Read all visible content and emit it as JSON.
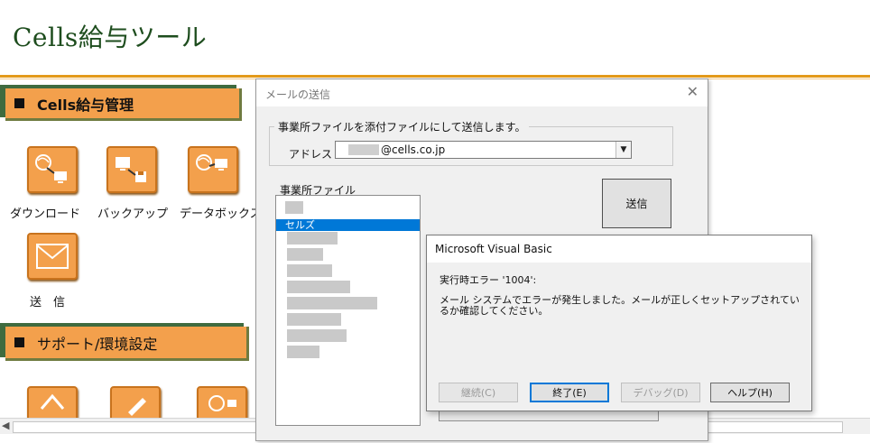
{
  "app": {
    "title": "Cells給与ツール"
  },
  "sections": [
    {
      "label": "Cells給与管理"
    },
    {
      "label": "サポート/環境設定"
    }
  ],
  "tools": [
    {
      "label": "ダウンロード",
      "icon": "download-icon"
    },
    {
      "label": "バックアップ",
      "icon": "backup-icon"
    },
    {
      "label": "データボックス",
      "icon": "databox-icon"
    },
    {
      "label": "送　信",
      "icon": "mail-icon"
    }
  ],
  "mail_dialog": {
    "title": "メールの送信",
    "group_legend": "事業所ファイルを添付ファイルにして送信します。",
    "address_label": "アドレス",
    "address_value": "@cells.co.jp",
    "files_label": "事業所ファイル",
    "selected_file": "セルズ",
    "send_label": "送信"
  },
  "vb_dialog": {
    "title": "Microsoft Visual Basic",
    "error_line": "実行時エラー '1004':",
    "message": "メール システムでエラーが発生しました。メールが正しくセットアップされているか確認してください。",
    "buttons": {
      "continue": "継続(C)",
      "end": "終了(E)",
      "debug": "デバッグ(D)",
      "help": "ヘルプ(H)"
    }
  },
  "colors": {
    "accent_orange": "#f3a04c",
    "title_green": "#1e4d1e",
    "selection_blue": "#0078d7"
  }
}
